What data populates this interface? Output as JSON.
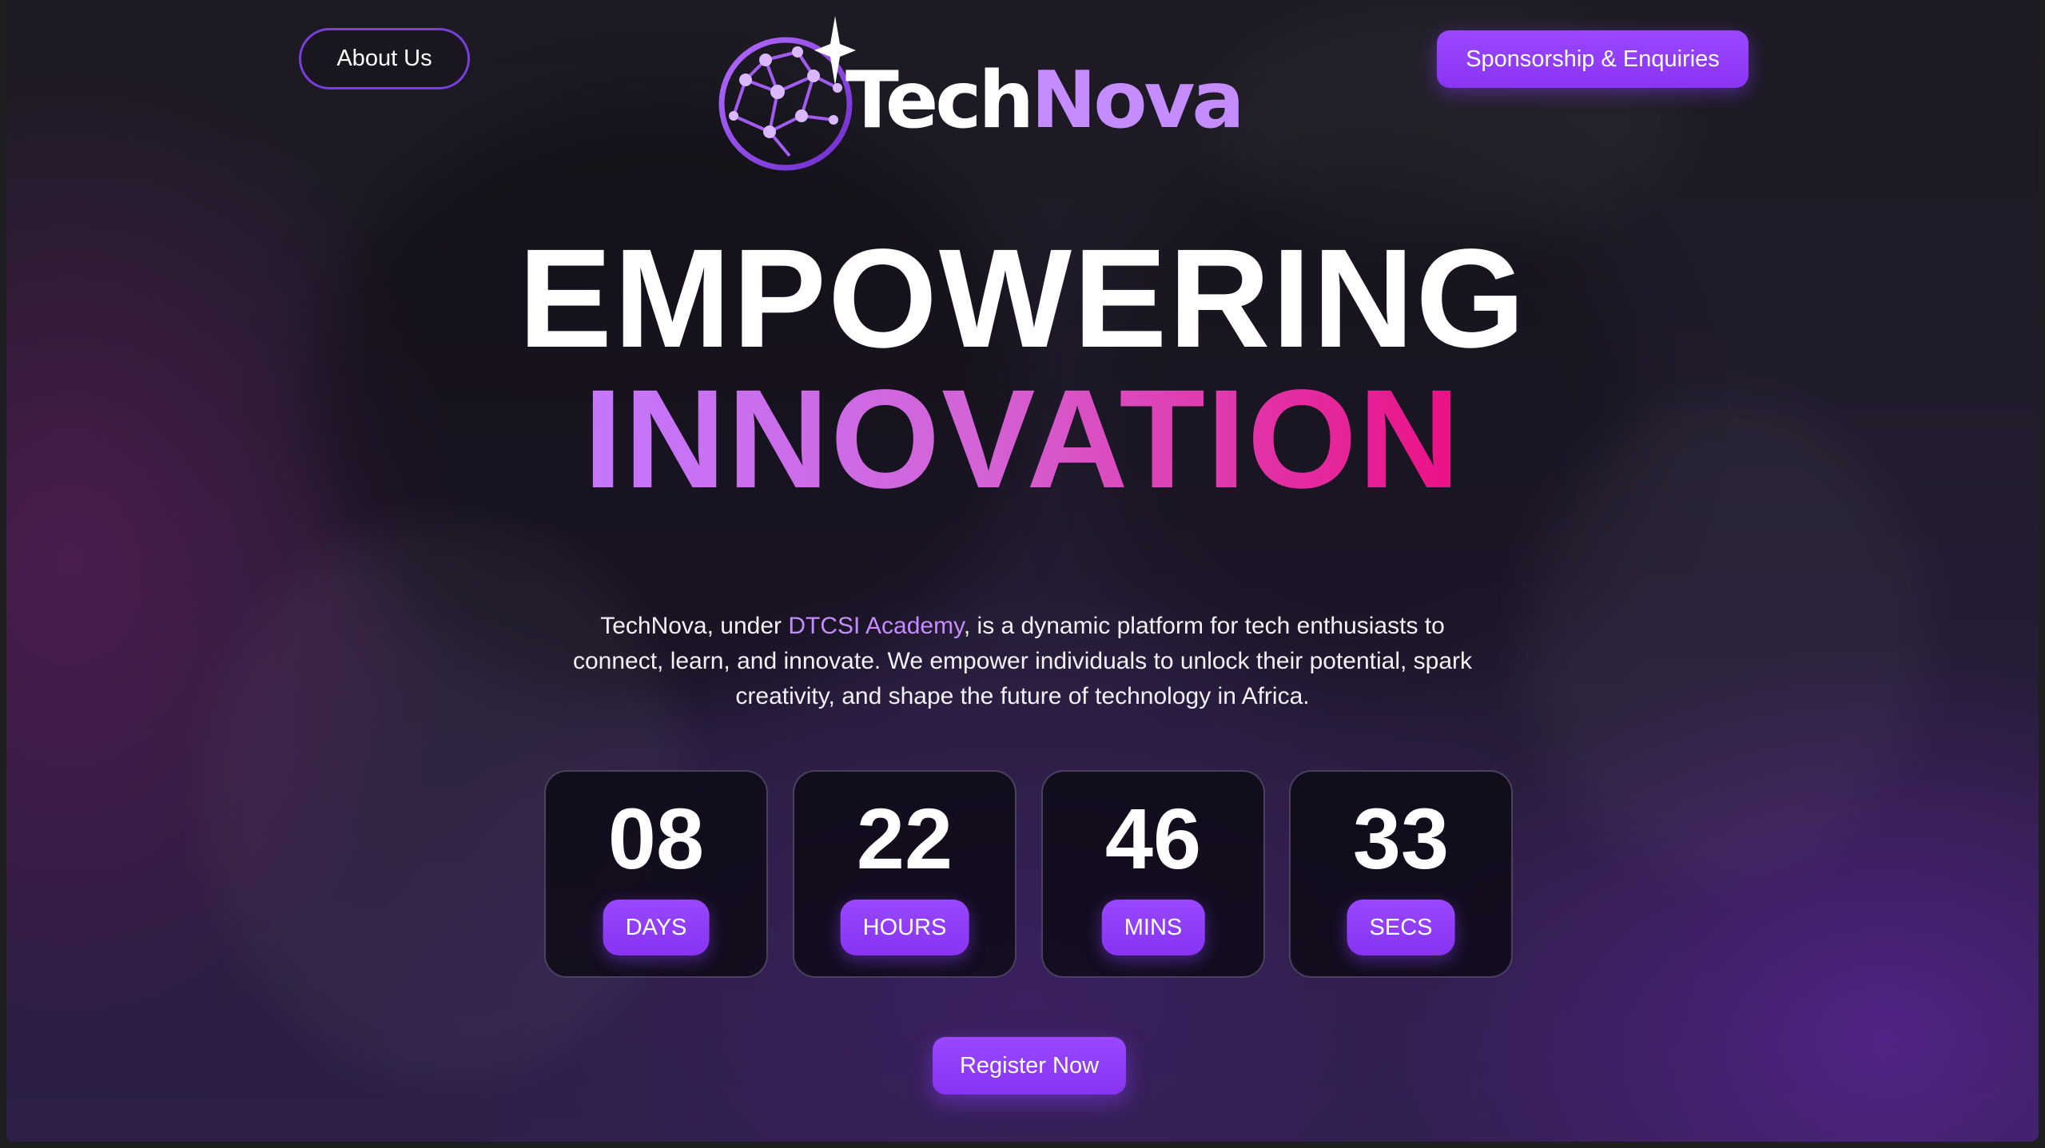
{
  "header": {
    "about_label": "About Us",
    "sponsor_label": "Sponsorship & Enquiries",
    "logo": {
      "part1": "Tech",
      "part2": "Nova",
      "icon": "globe-network-icon"
    }
  },
  "hero": {
    "headline_line1": "EMPOWERING",
    "headline_line2": "INNOVATION",
    "description": {
      "prefix": "TechNova, under ",
      "link_text": "DTCSI Academy",
      "suffix": ", is a dynamic platform for tech enthusiasts to connect, learn, and innovate. We empower individuals to unlock their potential, spark creativity, and shape the future of technology in Africa."
    }
  },
  "countdown": {
    "days": {
      "value": "08",
      "label": "DAYS"
    },
    "hours": {
      "value": "22",
      "label": "HOURS"
    },
    "mins": {
      "value": "46",
      "label": "MINS"
    },
    "secs": {
      "value": "33",
      "label": "SECS"
    }
  },
  "cta": {
    "register_label": "Register Now"
  },
  "colors": {
    "accent": "#8f3ff7",
    "gradient_start": "#c477ff",
    "gradient_end": "#ec0f84",
    "logo_nova": "#c58cff",
    "background": "#221c2e"
  }
}
